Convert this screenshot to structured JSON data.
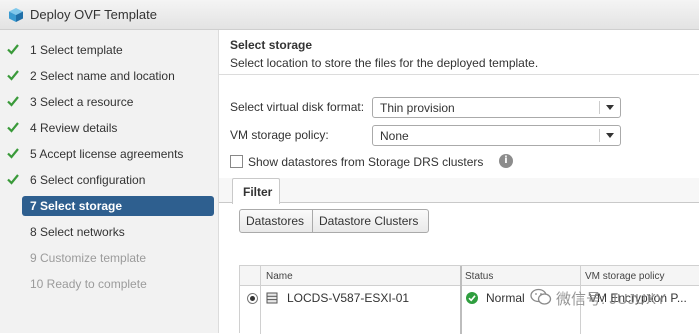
{
  "window": {
    "title": "Deploy OVF Template"
  },
  "steps": [
    {
      "label": "1  Select template",
      "state": "done"
    },
    {
      "label": "2  Select name and location",
      "state": "done"
    },
    {
      "label": "3  Select a resource",
      "state": "done"
    },
    {
      "label": "4  Review details",
      "state": "done"
    },
    {
      "label": "5  Accept license agreements",
      "state": "done"
    },
    {
      "label": "6  Select configuration",
      "state": "done"
    },
    {
      "label": "7  Select storage",
      "state": "selected"
    },
    {
      "label": "8  Select networks",
      "state": "pending"
    },
    {
      "label": "9  Customize template",
      "state": "disabled"
    },
    {
      "label": "10  Ready to complete",
      "state": "disabled"
    }
  ],
  "main": {
    "title": "Select storage",
    "subtitle": "Select location to store the files for the deployed template.",
    "disk_format": {
      "label": "Select virtual disk format:",
      "value": "Thin provision"
    },
    "storage_policy": {
      "label": "VM storage policy:",
      "value": "None"
    },
    "show_drs": {
      "label": "Show datastores from Storage DRS clusters",
      "checked": false
    },
    "tab": "Filter",
    "segments": [
      "Datastores",
      "Datastore Clusters"
    ],
    "table": {
      "columns": [
        "Name",
        "Status",
        "VM storage policy"
      ],
      "rows": [
        {
          "name": "LOCDS-V587-ESXI-01",
          "status": "Normal",
          "policy": "VM Encryption P..."
        }
      ]
    }
  },
  "watermark": {
    "text": "微信号: JUJUXY"
  },
  "colors": {
    "selected": "#2e5f8f",
    "check": "#3a9a3a",
    "status_ok": "#2f9e3f"
  }
}
